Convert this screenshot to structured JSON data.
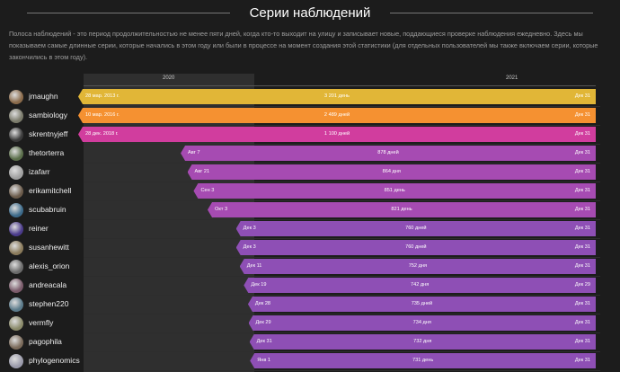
{
  "title": "Серии наблюдений",
  "description": "Полоса наблюдений - это период продолжительностью не менее пяти дней, когда кто-то выходит на улицу и записывает новые, поддающиеся проверке наблюдения ежедневно. Здесь мы показываем самые длинные серии, которые начались в этом году или были в процессе на момент создания этой статистики (для отдельных пользователей мы также включаем серии, которые закончились в этом году).",
  "years": [
    "2020",
    "2021"
  ],
  "colors": {
    "gold": "#e1b637",
    "orange": "#f59131",
    "magenta": "#d13d9e",
    "purple1": "#a64bb2",
    "purple2": "#8e4fb5"
  },
  "streaks": [
    {
      "user": "jmaughn",
      "start": "28 мар. 2013 г.",
      "count": "3 201 день",
      "end": "Дек 31",
      "color": "#e1b637",
      "start_frac": 0.0,
      "avatar": "#8a6a4a"
    },
    {
      "user": "sambiology",
      "start": "10 мар. 2016 г.",
      "count": "2 489 дней",
      "end": "Дек 31",
      "color": "#f59131",
      "start_frac": 0.0,
      "avatar": "#7a7a6a"
    },
    {
      "user": "skrentnyjeff",
      "start": "28 дек. 2018 г.",
      "count": "1 100 дней",
      "end": "Дек 31",
      "color": "#d13d9e",
      "start_frac": 0.0,
      "avatar": "#3a3a3a"
    },
    {
      "user": "thetorterra",
      "start": "Авг 7",
      "count": "878 дней",
      "end": "Дек 31",
      "color": "#a64bb2",
      "start_frac": 0.198,
      "avatar": "#5a6e4a"
    },
    {
      "user": "izafarr",
      "start": "Авг 21",
      "count": "864 дня",
      "end": "Дек 31",
      "color": "#a64bb2",
      "start_frac": 0.211,
      "avatar": "#a0a0a0"
    },
    {
      "user": "erikamitchell",
      "start": "Сен 3",
      "count": "851 день",
      "end": "Дек 31",
      "color": "#a64bb2",
      "start_frac": 0.223,
      "avatar": "#6a5a4a"
    },
    {
      "user": "scubabruin",
      "start": "Окт 3",
      "count": "821 день",
      "end": "Дек 31",
      "color": "#a64bb2",
      "start_frac": 0.25,
      "avatar": "#3c6a8a"
    },
    {
      "user": "reiner",
      "start": "Дек 3",
      "count": "760 дней",
      "end": "Дек 31",
      "color": "#8e4fb5",
      "start_frac": 0.305,
      "avatar": "#4a3a8a"
    },
    {
      "user": "susanhewitt",
      "start": "Дек 3",
      "count": "760 дней",
      "end": "Дек 31",
      "color": "#8e4fb5",
      "start_frac": 0.305,
      "avatar": "#8a7a5a"
    },
    {
      "user": "alexis_orion",
      "start": "Дек 11",
      "count": "752 дня",
      "end": "Дек 31",
      "color": "#8e4fb5",
      "start_frac": 0.312,
      "avatar": "#6a6a6a"
    },
    {
      "user": "andreacala",
      "start": "Дек 19",
      "count": "742 дня",
      "end": "Дек 29",
      "color": "#8e4fb5",
      "start_frac": 0.32,
      "avatar": "#7a5a6a"
    },
    {
      "user": "stephen220",
      "start": "Дек 28",
      "count": "735 дней",
      "end": "Дек 31",
      "color": "#8e4fb5",
      "start_frac": 0.328,
      "avatar": "#5a7a8a"
    },
    {
      "user": "vermfly",
      "start": "Дек 29",
      "count": "734 дня",
      "end": "Дек 31",
      "color": "#8e4fb5",
      "start_frac": 0.329,
      "avatar": "#8a8a6a"
    },
    {
      "user": "pagophila",
      "start": "Дек 31",
      "count": "732 дня",
      "end": "Дек 31",
      "color": "#8e4fb5",
      "start_frac": 0.331,
      "avatar": "#7a6a5a"
    },
    {
      "user": "phylogenomics",
      "start": "Янв 1",
      "count": "731 день",
      "end": "Дек 31",
      "color": "#8e4fb5",
      "start_frac": 0.332,
      "avatar": "#9a9aaa"
    }
  ]
}
